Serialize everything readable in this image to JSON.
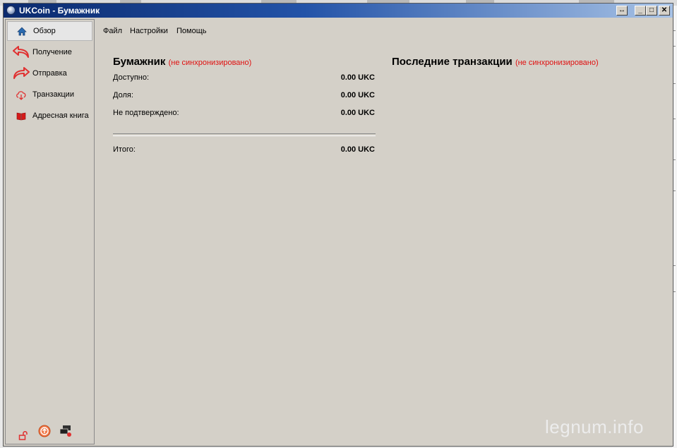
{
  "window": {
    "title": "UKCoin - Бумажник",
    "controls": {
      "resize_glyph": "↔",
      "minimize_glyph": "_",
      "maximize_glyph": "□",
      "close_glyph": "✕"
    }
  },
  "sidebar": {
    "items": [
      {
        "label": "Обзор",
        "icon": "home-icon",
        "active": true
      },
      {
        "label": "Получение",
        "icon": "receive-arrow-icon",
        "active": false
      },
      {
        "label": "Отправка",
        "icon": "send-arrow-icon",
        "active": false
      },
      {
        "label": "Транзакции",
        "icon": "transactions-icon",
        "active": false
      },
      {
        "label": "Адресная книга",
        "icon": "address-book-icon",
        "active": false
      }
    ],
    "bottom_icons": [
      "lock-icon",
      "sync-status-icon",
      "connections-icon"
    ]
  },
  "menu": {
    "file": "Файл",
    "settings": "Настройки",
    "help": "Помощь"
  },
  "wallet": {
    "title": "Бумажник",
    "status": "(не синхронизировано)",
    "rows": [
      {
        "label": "Доступно:",
        "value": "0.00 UKC"
      },
      {
        "label": "Доля:",
        "value": "0.00 UKC"
      },
      {
        "label": "Не подтверждено:",
        "value": "0.00 UKC"
      }
    ],
    "total": {
      "label": "Итого:",
      "value": "0.00 UKC"
    }
  },
  "transactions": {
    "title": "Последние транзакции",
    "status": "(не синхронизировано)"
  },
  "watermark": "legnum.info",
  "colors": {
    "accent_red": "#e01010",
    "titlebar": "#0b2a6e",
    "window_bg": "#d4d0c8",
    "icon_red": "#e03030"
  }
}
